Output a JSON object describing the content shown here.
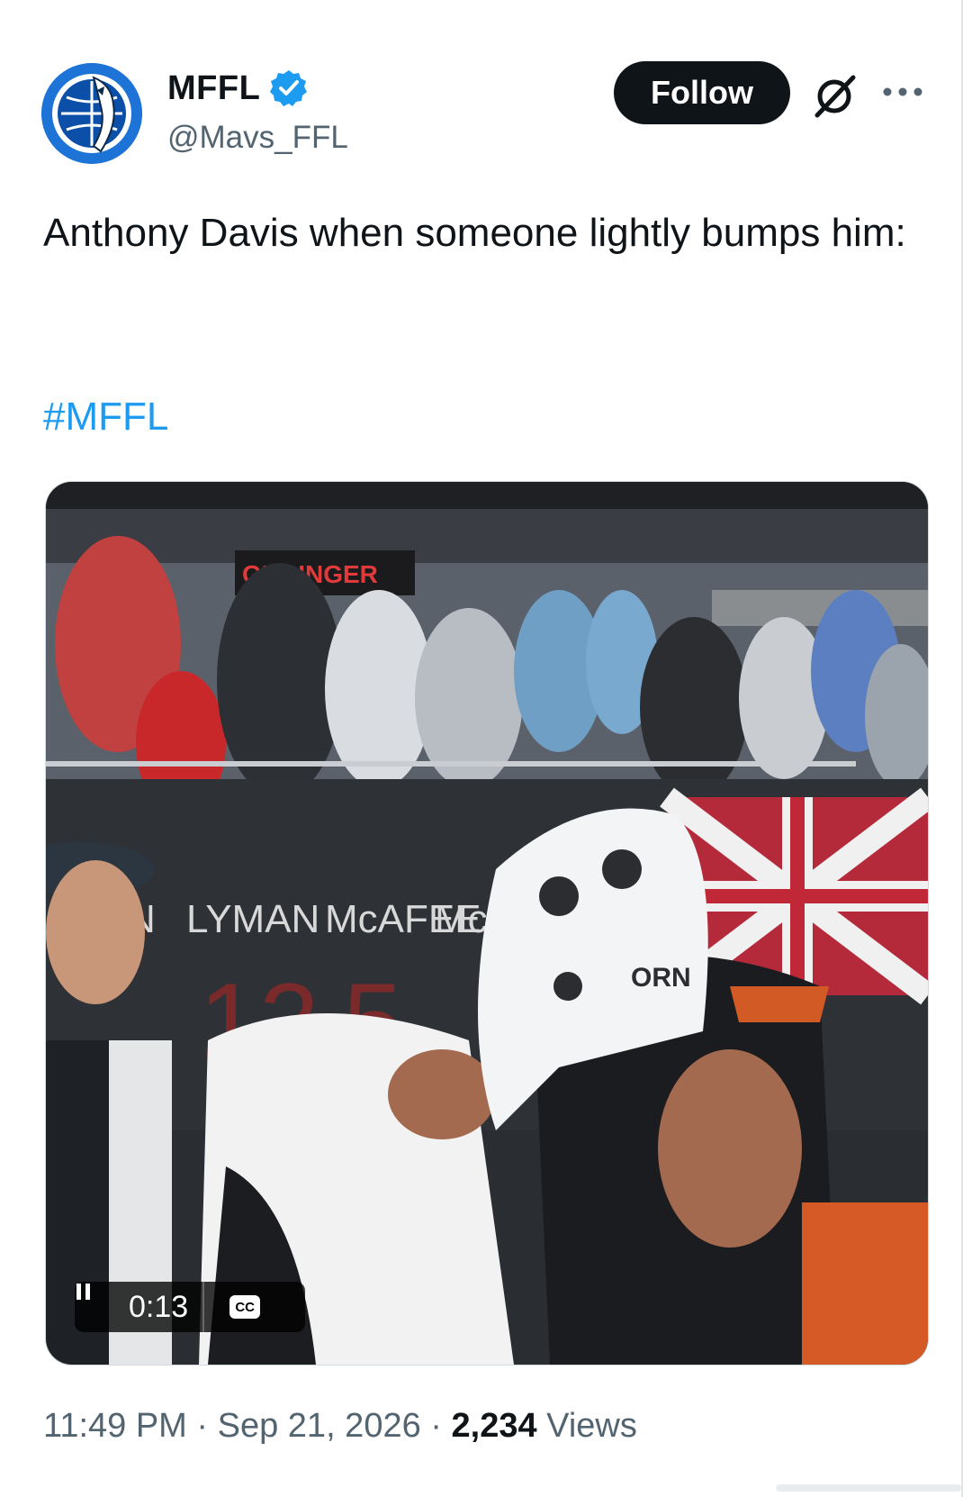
{
  "author": {
    "display_name": "MFFL",
    "handle": "@Mavs_FFL",
    "verified": true,
    "verified_color": "#1d9bf0",
    "avatar_icon": "mavericks-logo-icon",
    "avatar_color": "#1d73d6"
  },
  "actions": {
    "follow_label": "Follow",
    "grok_icon": "grok-icon",
    "more_icon": "more-options-icon"
  },
  "tweet": {
    "text": "Anthony Davis when someone lightly bumps him:",
    "hashtag": "#MFFL",
    "hashtag_color": "#1d9bf0"
  },
  "media": {
    "type": "video",
    "playing": true,
    "timecode": "0:13",
    "captions_label": "CC",
    "scene_text": {
      "sign": "GRAINGER",
      "wall_name_1": "LYMAN",
      "wall_number_1": "12",
      "wall_name_2": "McAFEE",
      "wall_number_2": "5",
      "wall_name_3": "McM",
      "wall_name_partial": "N",
      "towel_text": "ORN"
    }
  },
  "meta": {
    "time": "11:49 PM",
    "separator": "·",
    "date": "Sep 21, 2026",
    "views_count": "2,234",
    "views_label": "Views"
  }
}
